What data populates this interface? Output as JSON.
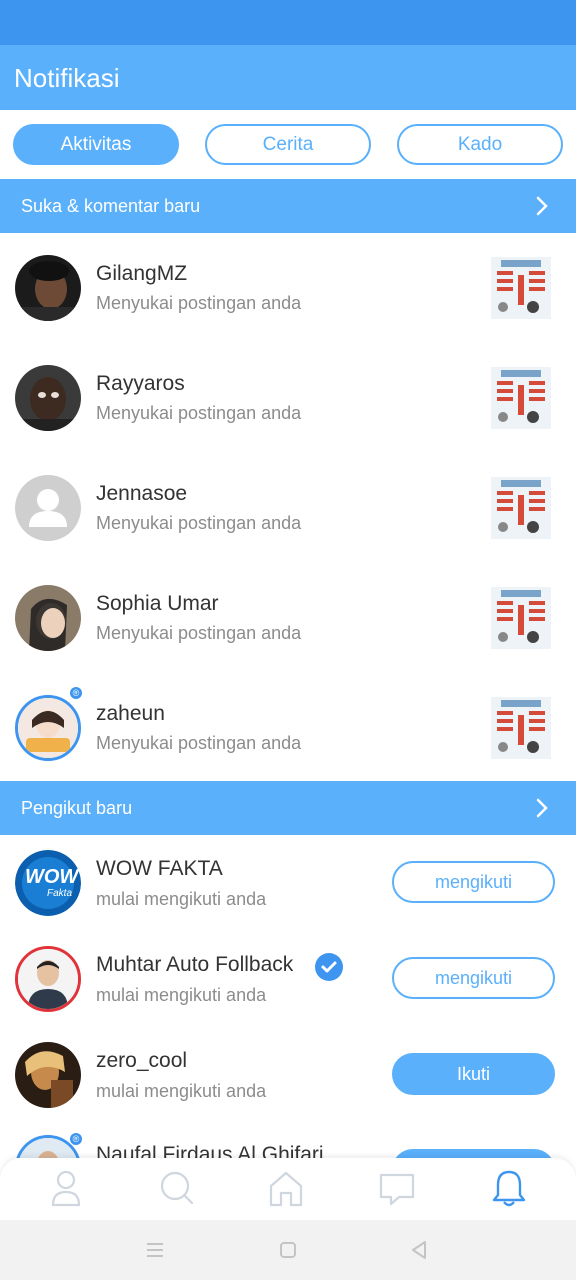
{
  "app": {
    "title": "Notifikasi",
    "accent": "#5ab0fb",
    "statusbar_color": "#3d95ef"
  },
  "tabs": [
    {
      "label": "Aktivitas",
      "active": true
    },
    {
      "label": "Cerita",
      "active": false
    },
    {
      "label": "Kado",
      "active": false
    }
  ],
  "likes_section": {
    "title": "Suka & komentar baru",
    "items": [
      {
        "name": "GilangMZ",
        "action": "Menyukai postingan anda"
      },
      {
        "name": "Rayyaros",
        "action": "Menyukai postingan anda"
      },
      {
        "name": "Jennasoe",
        "action": "Menyukai postingan anda"
      },
      {
        "name": "Sophia Umar",
        "action": "Menyukai postingan anda"
      },
      {
        "name": "zaheun",
        "action": "Menyukai postingan anda"
      }
    ]
  },
  "followers_section": {
    "title": "Pengikut baru",
    "items": [
      {
        "name": "WOW FAKTA",
        "action": "mulai mengikuti anda",
        "button": "mengikuti",
        "verified": false
      },
      {
        "name": "Muhtar Auto Follback",
        "action": "mulai mengikuti anda",
        "button": "mengikuti",
        "verified": true
      },
      {
        "name": "zero_cool",
        "action": "mulai mengikuti anda",
        "button": "Ikuti",
        "verified": false
      },
      {
        "name": "Naufal Firdaus Al Ghifari",
        "action": "",
        "button": "",
        "verified": false
      }
    ],
    "wow_logo_text": "WOW",
    "wow_logo_sub": "Fakta"
  },
  "bottom_nav": {
    "items": [
      "profile-icon",
      "search-icon",
      "home-icon",
      "chat-icon",
      "bell-icon"
    ],
    "active": "bell-icon"
  },
  "system_nav": [
    "menu-icon",
    "square-home-icon",
    "back-icon"
  ]
}
